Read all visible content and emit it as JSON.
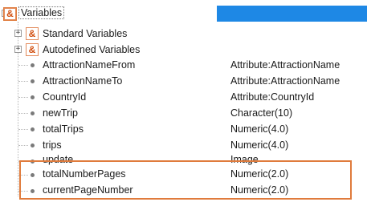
{
  "root": {
    "label": "Variables",
    "expander": "−",
    "icon": "&"
  },
  "groups": [
    {
      "label": "Standard Variables",
      "expander": "+",
      "icon": "&"
    },
    {
      "label": "Autodefined Variables",
      "expander": "+",
      "icon": "&"
    }
  ],
  "variables": [
    {
      "name": "AttractionNameFrom",
      "type": "Attribute:AttractionName"
    },
    {
      "name": "AttractionNameTo",
      "type": "Attribute:AttractionName"
    },
    {
      "name": "CountryId",
      "type": "Attribute:CountryId"
    },
    {
      "name": "newTrip",
      "type": "Character(10)"
    },
    {
      "name": "totalTrips",
      "type": "Numeric(4.0)"
    },
    {
      "name": "trips",
      "type": "Numeric(4.0)"
    },
    {
      "name": "update",
      "type": "Image"
    },
    {
      "name": "totalNumberPages",
      "type": "Numeric(2.0)"
    },
    {
      "name": "currentPageNumber",
      "type": "Numeric(2.0)"
    }
  ],
  "colors": {
    "selection": "#1e88e5",
    "highlight": "#e07b3c",
    "amp_icon": "#d24f0f"
  }
}
